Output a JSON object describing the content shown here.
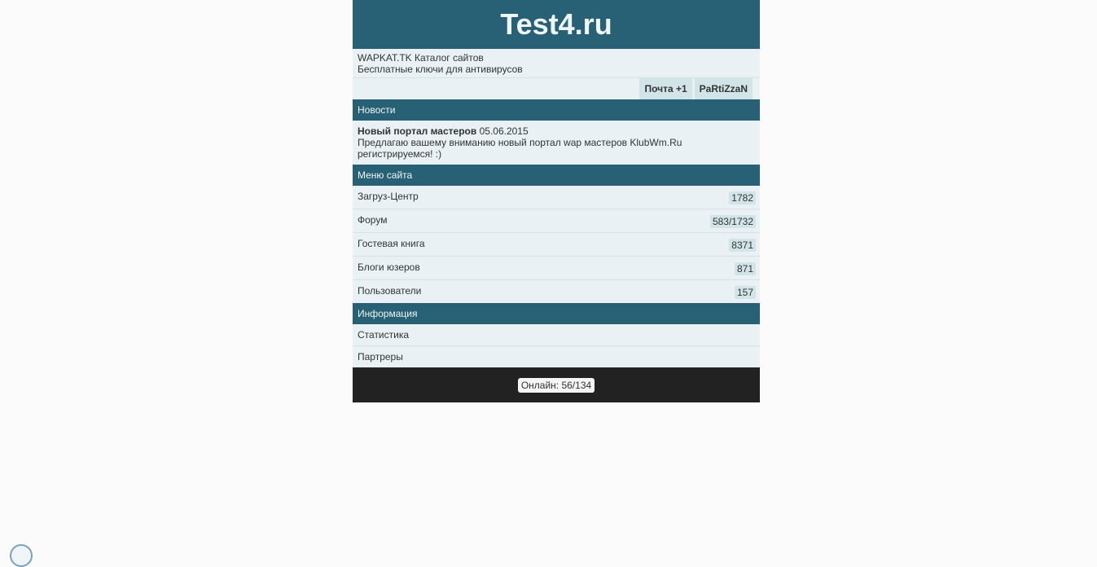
{
  "header": {
    "title": "Test4.ru"
  },
  "top_links": [
    "WAPKAT.TK Каталог сайтов",
    "Бесплатные ключи для антивирусов"
  ],
  "user_bar": {
    "mail_label": "Почта +1",
    "user_label": "PaRtiZzaN"
  },
  "news_section": {
    "header": "Новости",
    "item": {
      "title": "Новый портал мастеров",
      "date": "05.06.2015",
      "text": "Предлагаю вашему вниманию новый портал wap мастеров KlubWm.Ru регистрируемся! :)"
    }
  },
  "menu_section": {
    "header": "Меню сайта",
    "items": [
      {
        "label": "Загруз-Центр",
        "count": "1782"
      },
      {
        "label": "Форум",
        "count": "583/1732"
      },
      {
        "label": "Гостевая книга",
        "count": "8371"
      },
      {
        "label": "Блоги юзеров",
        "count": "871"
      },
      {
        "label": "Пользователи",
        "count": "157"
      }
    ]
  },
  "info_section": {
    "header": "Информация",
    "items": [
      {
        "label": "Статистика"
      },
      {
        "label": "Партреры"
      }
    ]
  },
  "footer": {
    "online": "Онлайн: 56/134"
  },
  "colors": {
    "header_bg": "#286175",
    "block_bg": "#e9f1f4",
    "badge_bg": "#d1e5e9",
    "footer_bg": "#222222",
    "page_bg": "#fbfbfb"
  },
  "icons": {
    "corner": "globe-icon"
  }
}
